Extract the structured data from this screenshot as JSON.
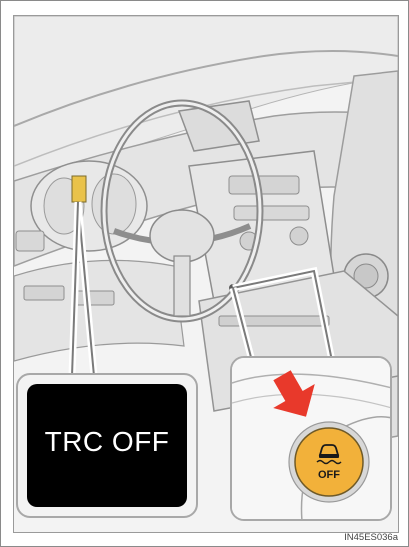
{
  "figure": {
    "indicator_text": "TRC OFF",
    "switch_label": "OFF",
    "caption": "IN45ES036a"
  },
  "colors": {
    "indicator_background": "#000000",
    "indicator_light": "#e9c24a",
    "switch_button": "#f2b13a",
    "arrow": "#e8392b"
  },
  "icons": {
    "switch_symbol": "skidding-car-icon",
    "pointer": "red-arrow-icon"
  }
}
